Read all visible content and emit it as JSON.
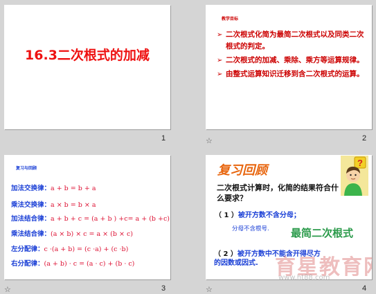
{
  "slides": [
    {
      "number": "1",
      "title": "16.3二次根式的加减"
    },
    {
      "number": "2",
      "label": "教学目标",
      "bullets": [
        "二次根式化简为最简二次根式以及同类二次根式的判定。",
        "二次根式的加减、乘除、乘方等运算规律。",
        "由整式运算知识迁移到含二次根式的运算。"
      ]
    },
    {
      "number": "3",
      "label": "复习与回顾",
      "laws": [
        {
          "name": "加法交换律：",
          "formula": "a + b = b + a"
        },
        {
          "name": "乘法交换律：",
          "formula": "a × b = b × a"
        },
        {
          "name": "加法结合律：",
          "formula": "a + b + c = (a + b ) +c= a + (b +c)"
        },
        {
          "name": "乘法结合律：",
          "formula": "(a × b) × c = a × (b × c)"
        },
        {
          "name": "左分配律：",
          "formula": "c ·(a + b) = (c ·a) + (c ·b)"
        },
        {
          "name": "右分配律：",
          "formula": "(a + b) · c = (a · c) + (b · c)"
        }
      ]
    },
    {
      "number": "4",
      "heading": "复习回顾",
      "question": "二次根式计算时，化简的结果符合什么要求？",
      "cond1_num": "（ 1 ）",
      "cond1_text": "被开方数不含分母；",
      "sublabel": "分母不含根号.",
      "simplest": "最简二次根式",
      "cond2_num": "（ 2 ）",
      "cond2_text": "被开方数中不能含开得尽方的因数或因式.",
      "watermark": "育星教育网",
      "watermark_url": "www.ht88.com"
    }
  ],
  "icons": {
    "star": "☆"
  },
  "colors": {
    "red": "#ee1111",
    "blue": "#1a3fd6",
    "orange": "#e8660f",
    "green": "#2a9a4a"
  }
}
